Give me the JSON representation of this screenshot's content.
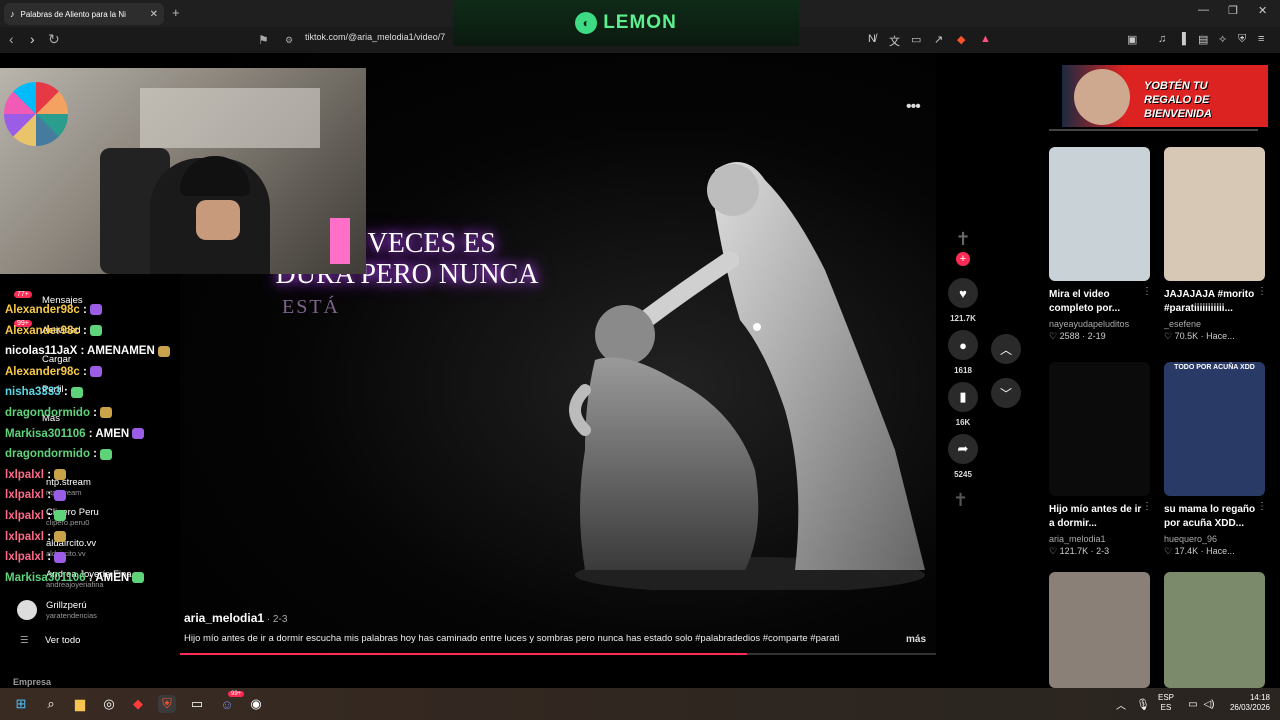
{
  "browser": {
    "tab_title": "Palabras de Aliento para la Ni",
    "url": "tiktok.com/@aria_melodia1/video/7",
    "new_tab": "+",
    "tab_close": "✕"
  },
  "lemon_banner": {
    "text": "LEMON"
  },
  "video": {
    "lyrics_line1": "A A VECES ES",
    "lyrics_line2": "DURA PERO NUNCA",
    "lyrics_line3": "ESTÁ",
    "author": "aria_melodia1",
    "date": " · 2-3",
    "caption": "Hijo mío antes de ir a dormir escucha mis palabras hoy has caminado entre luces y sombras pero nunca has estado solo #palabradedios #comparte #parati",
    "more_label": "más",
    "progress": 0.75
  },
  "actions": {
    "likes": "121.7K",
    "comments": "1618",
    "saves": "16K",
    "shares": "5245"
  },
  "sidebar": {
    "messages": "Mensajes",
    "activity": "Actividad",
    "upload": "Cargar",
    "profile": "Perfil",
    "more": "Más",
    "badge_messages": "99+",
    "badge_top": "77+",
    "following": [
      {
        "name": "ntp.stream",
        "handle": "ntp.stream"
      },
      {
        "name": "Clipero Peru",
        "handle": "clipero.peru0"
      },
      {
        "name": "aldaircito.vv",
        "handle": "aldaircito.vv"
      },
      {
        "name": "Andrea Joyería Fina",
        "handle": "andreajoyeriafina"
      },
      {
        "name": "Grillzperú",
        "handle": "yaratendencias"
      }
    ],
    "see_all": "Ver todo",
    "company": "Empresa"
  },
  "chat": [
    {
      "user": "Alexander98c",
      "msg": ":",
      "color": "#f7c948"
    },
    {
      "user": "Alexander98c",
      "msg": ":",
      "color": "#f7c948"
    },
    {
      "user": "nicolas11JaX",
      "msg": ": AMENAMEN",
      "color": "#ffffff"
    },
    {
      "user": "Alexander98c",
      "msg": ":",
      "color": "#f7c948"
    },
    {
      "user": "nisha3333",
      "msg": ":",
      "color": "#5ad8e6"
    },
    {
      "user": "dragondormido",
      "msg": ":",
      "color": "#5fd37a"
    },
    {
      "user": "Markisa301106",
      "msg": ": AMEN",
      "color": "#5fd37a"
    },
    {
      "user": "dragondormido",
      "msg": ":",
      "color": "#5fd37a"
    },
    {
      "user": "lxlpalxl",
      "msg": ":",
      "color": "#ff6b8a"
    },
    {
      "user": "lxlpalxl",
      "msg": ":",
      "color": "#ff6b8a"
    },
    {
      "user": "lxlpalxl",
      "msg": ":",
      "color": "#ff6b8a"
    },
    {
      "user": "lxlpalxl",
      "msg": ":",
      "color": "#ff6b8a"
    },
    {
      "user": "lxlpalxl",
      "msg": ":",
      "color": "#ff6b8a"
    },
    {
      "user": "Markisa301106",
      "msg": ": AMEN",
      "color": "#5fd37a"
    }
  ],
  "ad_banner": {
    "text": "YOBTÉN TU REGALO DE BIENVENIDA"
  },
  "recommendations": [
    {
      "title": "Mira el video completo por...",
      "user": "nayeayudapeluditos",
      "likes": "2588",
      "date": "2-19",
      "thumb_color": "#c9d2d6"
    },
    {
      "title": "JAJAJAJA #morito #paratiiiiiiiiiii...",
      "user": "_esefene",
      "likes": "70.5K",
      "date": "Hace...",
      "thumb_color": "#d6c8b4"
    },
    {
      "title": "Hijo mío antes de ir a dormir...",
      "user": "aria_melodia1",
      "likes": "121.7K",
      "date": "2-3",
      "thumb_color": "#0b0b0b"
    },
    {
      "title": "su mama lo regaño por acuña XDD...",
      "user": "huequero_96",
      "likes": "17.4K",
      "date": "Hace...",
      "thumb_color": "#2a3a66",
      "overlay": "TODO POR ACUÑA XDD"
    }
  ],
  "taskbar": {
    "lang_top": "ESP",
    "lang_bottom": "ES",
    "time": "14:18",
    "date": "26/03/2026",
    "discord_badge": "99+"
  }
}
